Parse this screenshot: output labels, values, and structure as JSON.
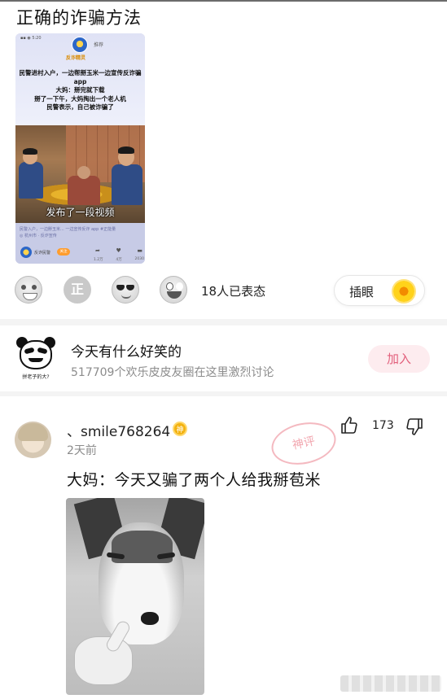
{
  "post": {
    "title": "正确的诈骗方法"
  },
  "video_card": {
    "status_bar": "▪▪ ◉ 5:20",
    "brand": "反诈精灵",
    "channel": "推荐",
    "overlay_text": "民警进村入户，一边帮掰玉米一边宣传反诈骗app\n大妈：掰完就下载\n掰了一下午，大妈掏出一个老人机\n民警表示，自己被诈骗了",
    "caption": "发布了一段视频",
    "desc_line1": "民警入户，一边掰玉米... 一边宣传反诈 app #正能量",
    "desc_line2": "◎ 杭州市 · 反诈宣传",
    "author": "反诈民警",
    "follow_label": "关注",
    "stats": [
      "1.2万",
      "4万",
      "2030"
    ]
  },
  "reactions": {
    "icons": [
      "laugh-emoji",
      "zheng-badge",
      "sunglasses-emoji",
      "shocked-emoji"
    ],
    "badge_text": "正",
    "count_label": "18人已表态",
    "action_label": "插眼",
    "action_icon": "sunflower-icon"
  },
  "circle": {
    "name": "今天有什么好笑的",
    "stats": "517709个欢乐皮皮友圈在这里激烈讨论",
    "join_label": "加入",
    "avatar_tag": "拼老子的大?"
  },
  "comment": {
    "username": "、smile768264",
    "badge": "神",
    "time": "2天前",
    "text": "大妈：今天又骗了两个人给我掰苞米",
    "like_count": "173",
    "stamp_text": "神评",
    "accent": "#e2607c"
  }
}
